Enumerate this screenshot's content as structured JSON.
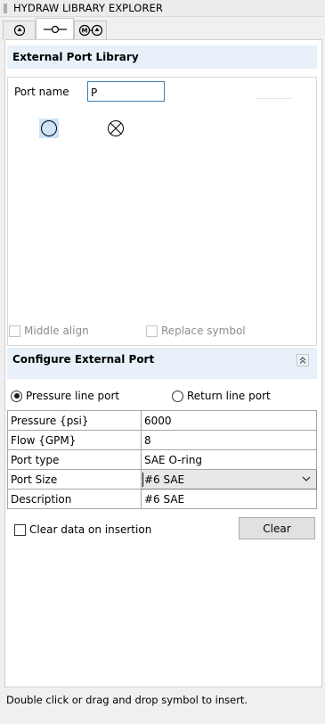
{
  "window": {
    "title": "HYDRAW LIBRARY EXPLORER"
  },
  "tabs": [
    {
      "icon": "pump-symbol-icon",
      "active": false
    },
    {
      "icon": "port-line-icon",
      "active": true
    },
    {
      "icon": "motor-pump-symbol-icon",
      "active": false
    }
  ],
  "library": {
    "header": "External Port Library",
    "port_name_label": "Port name",
    "port_name_value": "P",
    "symbols": [
      {
        "icon": "pressure-port-circle-icon",
        "selected": true
      },
      {
        "icon": "return-port-crossed-circle-icon",
        "selected": false
      }
    ],
    "middle_align_label": "Middle align",
    "replace_symbol_label": "Replace symbol"
  },
  "configure": {
    "header": "Configure External Port",
    "pressure_radio_label": "Pressure line port",
    "return_radio_label": "Return line port",
    "properties": [
      {
        "key": "Pressure {psi}",
        "value": "6000"
      },
      {
        "key": "Flow {GPM}",
        "value": "8"
      },
      {
        "key": "Port type",
        "value": "SAE O-ring"
      },
      {
        "key": "Port Size",
        "value": "#6 SAE"
      },
      {
        "key": "Description",
        "value": "#6 SAE"
      }
    ],
    "clear_on_insert_label": "Clear data on insertion",
    "clear_button_label": "Clear"
  },
  "status": {
    "text": "Double click or drag and drop symbol to insert."
  },
  "colors": {
    "accent_input_border": "#3c7fb1",
    "section_header_bg": "#e8f1f9",
    "selected_symbol_fill": "#cde3f7"
  }
}
